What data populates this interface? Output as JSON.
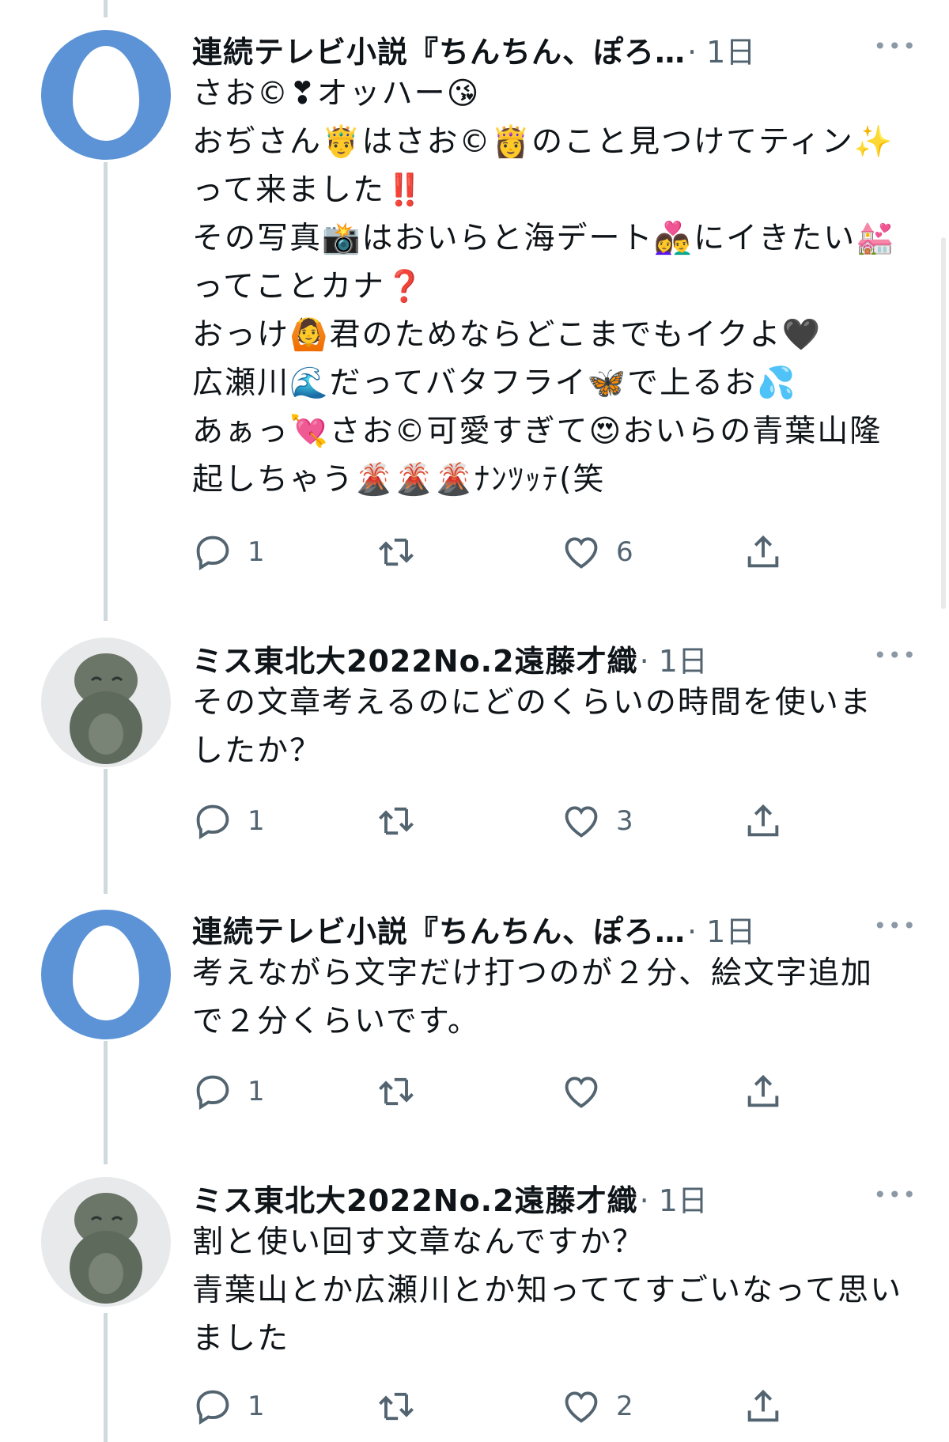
{
  "tweets": [
    {
      "author": "連続テレビ小説『ちんちん、ぽろ…",
      "time": "· 1日",
      "avatar": "egg-avatar",
      "body": "さお©︎❣オッハー😘\nおぢさん🤴はさお©︎👸のこと見つけてティン✨って来ました‼️\nその写真📸はおいらと海デート👩‍❤️‍👨にイきたい💒ってことカナ❓\nおっけ🙆君のためならどこまでもイクよ🖤\n広瀬川🌊だってバタフライ🦋で上るお💦\nあぁっ💘さお©︎可愛すぎて😍おいらの青葉山隆起しちゃう🌋🌋🌋ﾅﾝﾂｯﾃ(笑",
      "replies": "1",
      "retweets": "",
      "likes": "6"
    },
    {
      "author": "ミス東北大2022No.2遠藤才織",
      "time": "· 1日",
      "avatar": "frog-avatar",
      "body": "その文章考えるのにどのくらいの時間を使いましたか？",
      "replies": "1",
      "retweets": "",
      "likes": "3"
    },
    {
      "author": "連続テレビ小説『ちんちん、ぽろ…",
      "time": "· 1日",
      "avatar": "egg-avatar",
      "body": "考えながら文字だけ打つのが２分、絵文字追加で２分くらいです。",
      "replies": "1",
      "retweets": "",
      "likes": ""
    },
    {
      "author": "ミス東北大2022No.2遠藤才織",
      "time": "· 1日",
      "avatar": "frog-avatar",
      "body": "割と使い回す文章なんですか？\n青葉山とか広瀬川とか知っててすごいなって思いました",
      "replies": "1",
      "retweets": "",
      "likes": "2"
    }
  ],
  "more_label": "•••",
  "colors": {
    "egg_avatar": "#5b93d6",
    "thread_line": "#cfd9de",
    "secondary_text": "#536471"
  }
}
